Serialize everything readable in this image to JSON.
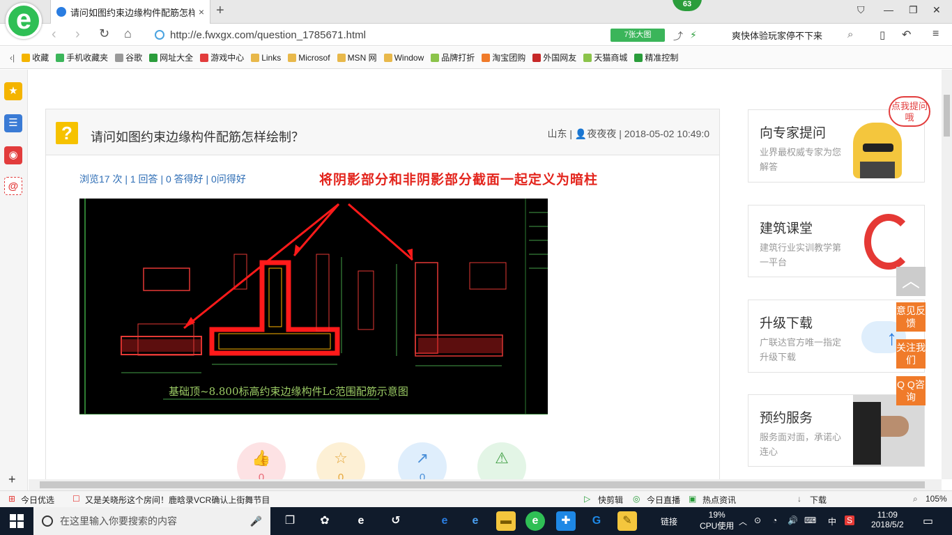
{
  "browser": {
    "logo_letter": "e",
    "tab_title": "请问如图约束边缘构件配筋怎样绘",
    "tab_close": "×",
    "new_tab": "+",
    "notification_count": "63",
    "url": "http://e.fwxgx.com/question_1785671.html",
    "big_image_label": "7张大图",
    "search_hint": "爽快体验玩家停不下来"
  },
  "bookmarks": [
    {
      "label": "收藏",
      "color": "#f4b400"
    },
    {
      "label": "手机收藏夹",
      "color": "#3bb55a"
    },
    {
      "label": "谷歌",
      "color": "#999999"
    },
    {
      "label": "网址大全",
      "color": "#2a9d3b"
    },
    {
      "label": "游戏中心",
      "color": "#e23c3c"
    },
    {
      "label": "Links",
      "color": "#e8b84a"
    },
    {
      "label": "Microsof",
      "color": "#e8b84a"
    },
    {
      "label": "MSN 网",
      "color": "#e8b84a"
    },
    {
      "label": "Window",
      "color": "#e8b84a"
    },
    {
      "label": "品牌打折",
      "color": "#8bc34a"
    },
    {
      "label": "淘宝团购",
      "color": "#f07b2a"
    },
    {
      "label": "外国网友",
      "color": "#c62828"
    },
    {
      "label": "天猫商城",
      "color": "#8bc34a"
    },
    {
      "label": "精准控制",
      "color": "#2a9d3b"
    }
  ],
  "question": {
    "title": "请问如图约束边缘构件配筋怎样绘制？",
    "meta": "山东 | 👤夜夜夜 | 2018-05-02 10:49:0",
    "stats": "浏览17 次 | 1 回答 | 0 答得好 | 0问得好",
    "red_annotation": "将阴影部分和非阴影部分截面一起定义为暗柱",
    "drawing_caption": "基础顶~8.800标高约束边缘构件Lc范围配筋示意图",
    "actions": [
      {
        "icon": "👍",
        "count": "0"
      },
      {
        "icon": "☆",
        "count": "0"
      },
      {
        "icon": "↗",
        "count": "0"
      },
      {
        "icon": "⚠",
        "count": ""
      }
    ]
  },
  "sidebar_cards": [
    {
      "heading": "向专家提问",
      "sub": "业界最权威专家为您解答"
    },
    {
      "heading": "建筑课堂",
      "sub": "建筑行业实训教学第一平台"
    },
    {
      "heading": "升级下载",
      "sub": "广联达官方唯一指定升级下载"
    },
    {
      "heading": "预约服务",
      "sub": "服务面对面，承诺心连心"
    }
  ],
  "bubble_text": "点我提问哦",
  "float_buttons": [
    "意见反馈",
    "关注我们",
    "Q Q咨询"
  ],
  "statusbar": {
    "today": "今日优选",
    "news": "又是关晓彤这个房间！鹿晗录VCR确认上街舞节目",
    "items": [
      "快剪辑",
      "今日直播",
      "热点资讯",
      "下载"
    ],
    "zoom": "105%"
  },
  "taskbar": {
    "search_placeholder": "在这里输入你要搜索的内容",
    "link_label": "链接",
    "cpu_percent": "19%",
    "cpu_label": "CPU使用",
    "ime": "中",
    "time": "11:09",
    "date": "2018/5/2"
  }
}
